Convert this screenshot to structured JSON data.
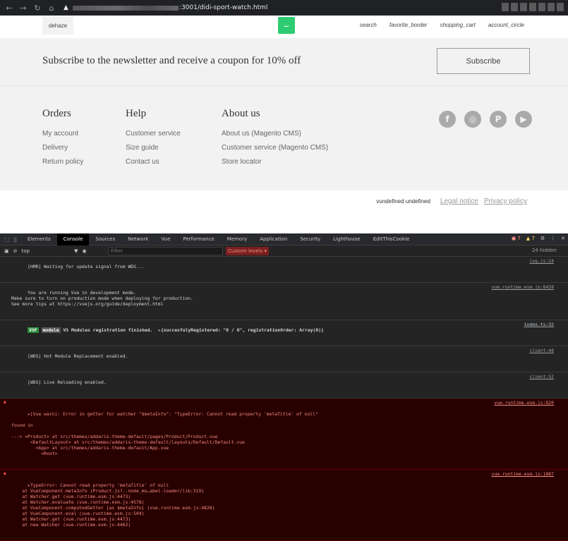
{
  "browser": {
    "url_suffix": ":3001/didi-sport-watch.html"
  },
  "header": {
    "menu_label": "dehaze",
    "icons": [
      "search",
      "favorite_border",
      "shopping_cart",
      "account_circle"
    ]
  },
  "newsletter": {
    "text": "Subscribe to the newsletter and receive a coupon for 10% off",
    "button": "Subscribe"
  },
  "footer": {
    "columns": [
      {
        "title": "Orders",
        "links": [
          "My account",
          "Delivery",
          "Return policy"
        ]
      },
      {
        "title": "Help",
        "links": [
          "Customer service",
          "Size guide",
          "Contact us"
        ]
      },
      {
        "title": "About us",
        "links": [
          "About us (Magento CMS)",
          "Customer service (Magento CMS)",
          "Store locator"
        ]
      }
    ],
    "social": [
      "facebook-icon",
      "instagram-icon",
      "pinterest-icon",
      "youtube-icon"
    ]
  },
  "bottom": {
    "version": "vundefined undefined",
    "legal": "Legal notice",
    "privacy": "Privacy policy"
  },
  "devtools": {
    "tabs": [
      "Elements",
      "Console",
      "Sources",
      "Network",
      "Vue",
      "Performance",
      "Memory",
      "Application",
      "Security",
      "Lighthouse",
      "EditThisCookie"
    ],
    "active_tab": "Console",
    "errors": "7",
    "warnings": "7",
    "context": "top",
    "filter_placeholder": "Filter",
    "levels": "Custom levels ▾",
    "hidden": "24 hidden",
    "messages": [
      {
        "type": "log",
        "text": "[HMR] Waiting for update signal from WDS...",
        "src": "log.js:24"
      },
      {
        "type": "log",
        "text": "You are running Vue in development mode.\nMake sure to turn on production mode when deploying for production.\nSee more tips at https://vuejs.org/guide/deployment.html",
        "src": "vue.runtime.esm.js:8428"
      },
      {
        "type": "vsf",
        "badge1": "VSF",
        "badge2": "module",
        "text": " VS Modules registration finished.  ▸{succesfulyRegistered: \"0 / 0\", registrationOrder: Array(0)}",
        "src": "index.ts:32"
      },
      {
        "type": "log",
        "text": "[WDS] Hot Module Replacement enabled.",
        "src": "client:48"
      },
      {
        "type": "log",
        "text": "[WDS] Live Reloading enabled.",
        "src": "client:52"
      },
      {
        "type": "error",
        "text": "▸[Vue warn]: Error in getter for watcher \"$metaInfo\": \"TypeError: Cannot read property 'metaTitle' of null\"\n\nfound in\n\n---> <Product> at src/themes/addaris-theme-default/pages/Product/Product.vue\n       <DefaultLayout> at src/themes/addaris-theme-default/layouts/Default/Default.vue\n         <App> at src/themes/addaris-theme-default/App.vue\n           <Root>",
        "src": "vue.runtime.esm.js:620"
      },
      {
        "type": "error",
        "text": "▸TypeError: Cannot read property 'metaTitle' of null\n    at VueComponent.metaInfo (Product.js?..node_mo…abel-loader/lib:319)\n    at Watcher.get (vue.runtime.esm.js:4473)\n    at Watcher.evaluate (vue.runtime.esm.js:4578)\n    at VueComponent.computedGetter [as $metaInfo] (vue.runtime.esm.js:4828)\n    at VueComponent.eval (vue.runtime.esm.js:504)\n    at Watcher.get (vue.runtime.esm.js:4473)\n    at new Watcher (vue.runtime.esm.js:4462)",
        "src": "vue.runtime.esm.js:1887"
      }
    ]
  }
}
